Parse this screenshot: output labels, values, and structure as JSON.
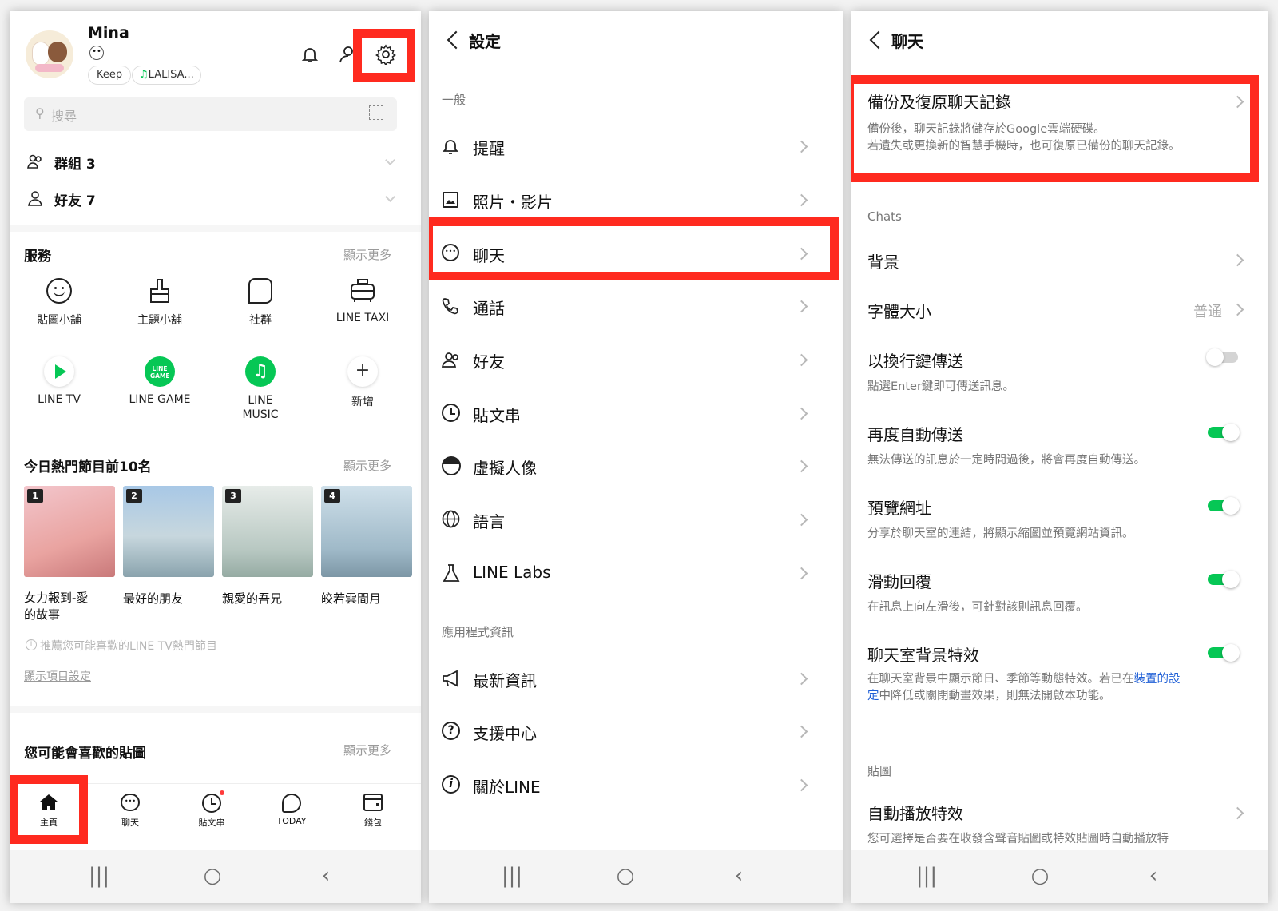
{
  "colors": {
    "highlight": "#ff2a1f",
    "line_green": "#06c755",
    "link_blue": "#1f5fd6"
  },
  "home": {
    "profile": {
      "name": "Mina",
      "chip_keep": "Keep",
      "chip_music": "LALISA..."
    },
    "search_placeholder": "搜尋",
    "groups_label": "群組 3",
    "friends_label": "好友 7",
    "services": {
      "title": "服務",
      "more": "顯示更多",
      "items": [
        {
          "label": "貼圖小舖",
          "icon": "smiley-icon"
        },
        {
          "label": "主題小舖",
          "icon": "brush-icon"
        },
        {
          "label": "社群",
          "icon": "community-icon"
        },
        {
          "label": "LINE TAXI",
          "icon": "taxi-icon"
        },
        {
          "label": "LINE TV",
          "icon": "play-icon"
        },
        {
          "label": "LINE GAME",
          "icon": "line-game-icon"
        },
        {
          "label": "LINE\nMUSIC",
          "icon": "music-icon"
        },
        {
          "label": "新增",
          "icon": "plus-icon"
        }
      ],
      "line_game_badge": "LINE GAME"
    },
    "top10": {
      "title": "今日熱門節目前10名",
      "more": "顯示更多",
      "items": [
        {
          "rank": "1",
          "title": "女力報到-愛\n的故事",
          "colors": [
            "#f3c6cc",
            "#e9a3a0"
          ]
        },
        {
          "rank": "2",
          "title": "最好的朋友",
          "colors": [
            "#a8c8e6",
            "#c7d7de"
          ]
        },
        {
          "rank": "3",
          "title": "親愛的吾兄",
          "colors": [
            "#e7ece9",
            "#b8c8c2"
          ]
        },
        {
          "rank": "4",
          "title": "皎若雲間月",
          "colors": [
            "#cfe0ea",
            "#9fb9c8"
          ]
        }
      ],
      "note": "推薦您可能喜歡的LINE TV熱門節目",
      "settings_link": "顯示項目設定"
    },
    "stickers": {
      "title": "您可能會喜歡的貼圖",
      "more": "顯示更多"
    },
    "tabs": [
      {
        "label": "主頁",
        "icon": "home-icon"
      },
      {
        "label": "聊天",
        "icon": "chat-icon"
      },
      {
        "label": "貼文串",
        "icon": "timeline-icon"
      },
      {
        "label": "TODAY",
        "icon": "today-icon"
      },
      {
        "label": "錢包",
        "icon": "wallet-icon"
      }
    ]
  },
  "settings": {
    "title": "設定",
    "section_general": "一般",
    "items": [
      {
        "label": "提醒",
        "icon": "bell-icon"
      },
      {
        "label": "照片・影片",
        "icon": "photo-icon"
      },
      {
        "label": "聊天",
        "icon": "chat-icon"
      },
      {
        "label": "通話",
        "icon": "phone-icon"
      },
      {
        "label": "好友",
        "icon": "friends-icon"
      },
      {
        "label": "貼文串",
        "icon": "clock-icon"
      },
      {
        "label": "虛擬人像",
        "icon": "avatar-icon"
      },
      {
        "label": "語言",
        "icon": "globe-icon"
      },
      {
        "label": "LINE Labs",
        "icon": "flask-icon"
      }
    ],
    "section_app": "應用程式資訊",
    "app_items": [
      {
        "label": "最新資訊",
        "icon": "megaphone-icon"
      },
      {
        "label": "支援中心",
        "icon": "help-icon"
      },
      {
        "label": "關於LINE",
        "icon": "info-icon"
      }
    ]
  },
  "chats": {
    "title": "聊天",
    "backup": {
      "title": "備份及復原聊天記錄",
      "desc1": "備份後，聊天記錄將儲存於Google雲端硬碟。",
      "desc2": "若遺失或更換新的智慧手機時，也可復原已備份的聊天記錄。"
    },
    "section_chats": "Chats",
    "background": "背景",
    "font_size": {
      "label": "字體大小",
      "value": "普通"
    },
    "enter_send": {
      "label": "以換行鍵傳送",
      "desc": "點選Enter鍵即可傳送訊息。",
      "on": false
    },
    "auto_resend": {
      "label": "再度自動傳送",
      "desc": "無法傳送的訊息於一定時間過後，將會再度自動傳送。",
      "on": true
    },
    "url_preview": {
      "label": "預覽網址",
      "desc": "分享於聊天室的連結，將顯示縮圖並預覽網站資訊。",
      "on": true
    },
    "swipe_reply": {
      "label": "滑動回覆",
      "desc": "在訊息上向左滑後，可針對該則訊息回覆。",
      "on": true
    },
    "bg_effect": {
      "label": "聊天室背景特效",
      "desc_a": "在聊天室背景中顯示節日、季節等動態特效。若已在",
      "desc_link1": "裝置的設",
      "desc_link2": "定",
      "desc_b": "中降低或關閉動畫效果，則無法開啟本功能。",
      "on": true
    },
    "section_stickers": "貼圖",
    "auto_play": {
      "label": "自動播放特效",
      "desc": "您可選擇是否要在收發含聲音貼圖或特效貼圖時自動播放特"
    }
  },
  "system_nav": {
    "recents": "|||",
    "home": "○",
    "back": "‹"
  }
}
